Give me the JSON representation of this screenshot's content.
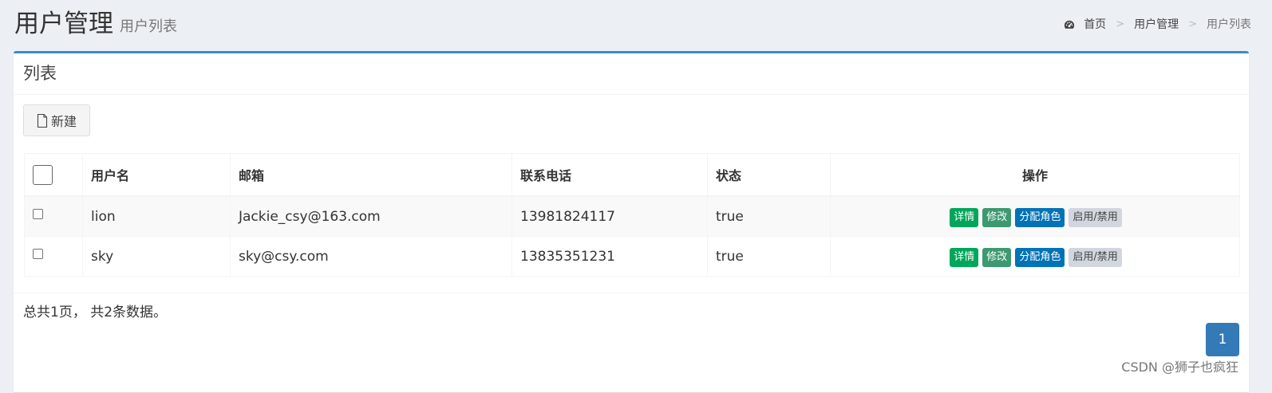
{
  "header": {
    "title": "用户管理",
    "subtitle": "用户列表",
    "breadcrumb": {
      "home": "首页",
      "separator": ">",
      "section": "用户管理",
      "current": "用户列表",
      "home_icon": "dashboard-icon"
    }
  },
  "box": {
    "title": "列表",
    "new_button": {
      "label": "新建",
      "icon": "file-icon"
    }
  },
  "table": {
    "headers": {
      "username": "用户名",
      "email": "邮箱",
      "phone": "联系电话",
      "status": "状态",
      "actions": "操作"
    },
    "rows": [
      {
        "username": "lion",
        "email": "Jackie_csy@163.com",
        "phone": "13981824117",
        "status": "true"
      },
      {
        "username": "sky",
        "email": "sky@csy.com",
        "phone": "13835351231",
        "status": "true"
      }
    ],
    "actions": {
      "detail": "详情",
      "edit": "修改",
      "assign_role": "分配角色",
      "toggle": "启用/禁用"
    }
  },
  "footer": {
    "summary": "总共1页， 共2条数据。",
    "current_page": "1"
  },
  "watermark": "CSDN @狮子也疯狂",
  "colors": {
    "accent": "#3c8dbc",
    "detail": "#00a65a",
    "edit": "#3d9970",
    "role": "#0073b7",
    "toggle": "#d2d6de",
    "page_active": "#337ab7"
  }
}
